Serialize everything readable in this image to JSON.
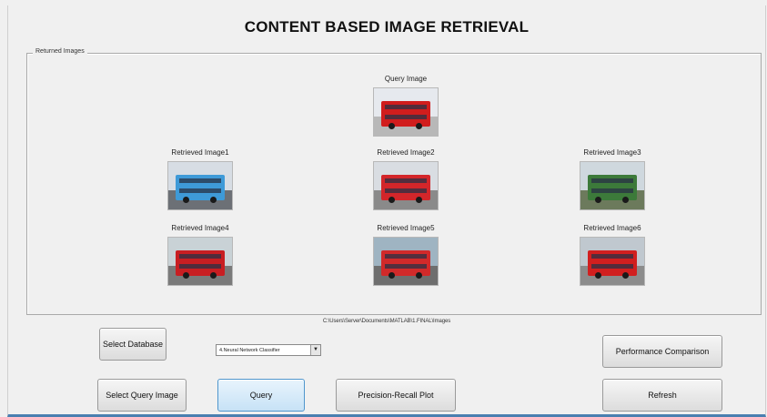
{
  "window": {
    "title": "CONTENT BASED IMAGE RETRIEVAL"
  },
  "panel": {
    "legend": "Returned Images",
    "query": {
      "label": "Query Image",
      "colors": {
        "sky": "#e6e9ee",
        "ground": "#b8b8b8",
        "bus": "#d11d1d"
      }
    },
    "retrieved": [
      {
        "label": "Retrieved Image1",
        "colors": {
          "sky": "#d7dde4",
          "ground": "#6c7076",
          "bus": "#3e9ad8"
        }
      },
      {
        "label": "Retrieved Image2",
        "colors": {
          "sky": "#d9dde2",
          "ground": "#8a8a8a",
          "bus": "#d3262a"
        }
      },
      {
        "label": "Retrieved Image3",
        "colors": {
          "sky": "#cfd8de",
          "ground": "#6c7a5c",
          "bus": "#3c7a3a"
        }
      },
      {
        "label": "Retrieved Image4",
        "colors": {
          "sky": "#c9d2d6",
          "ground": "#7a7a7a",
          "bus": "#c81e22"
        }
      },
      {
        "label": "Retrieved Image5",
        "colors": {
          "sky": "#9fb4c2",
          "ground": "#6e6e6e",
          "bus": "#d12a2a"
        }
      },
      {
        "label": "Retrieved Image6",
        "colors": {
          "sky": "#c0c8cf",
          "ground": "#8c8c8c",
          "bus": "#d11f1f"
        }
      }
    ]
  },
  "path_text": "C:\\Users\\Server\\Documents\\MATLAB\\1.FINAL\\Images",
  "classifier_select": {
    "value": "4.Neural Network Classifier"
  },
  "buttons": {
    "select_database": "Select Database",
    "select_query_image": "Select Query Image",
    "query": "Query",
    "precision_recall": "Precision-Recall Plot",
    "performance_comparison": "Performance Comparison",
    "refresh": "Refresh"
  }
}
